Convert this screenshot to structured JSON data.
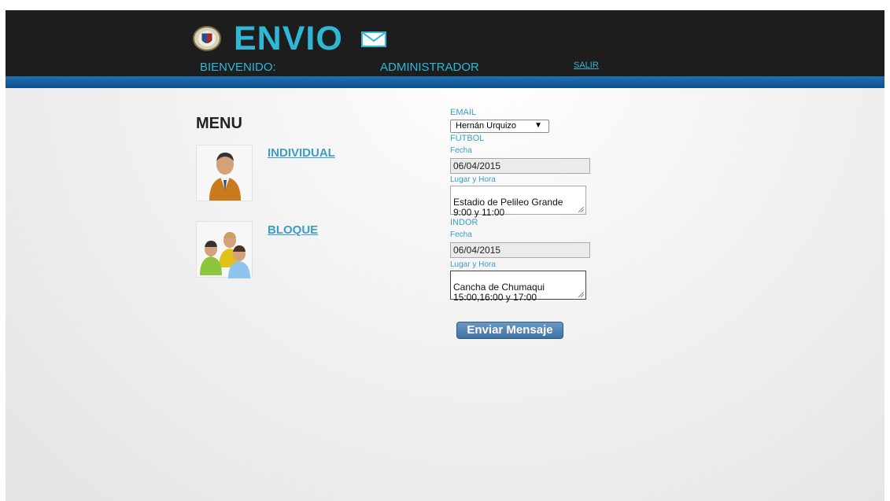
{
  "header": {
    "logo_text": "ENVIO",
    "welcome_label": "BIENVENIDO:",
    "user_name": "ADMINISTRADOR",
    "logout_label": "SALIR"
  },
  "menu": {
    "title": "MENU",
    "items": [
      {
        "label": "INDIVIDUAL",
        "icon": "single-user-icon"
      },
      {
        "label": "BLOQUE",
        "icon": "user-group-icon"
      }
    ]
  },
  "form": {
    "email_label": "EMAIL",
    "email_selected": "Hernán Urquizo",
    "futbol": {
      "section_label": "FÚTBOL",
      "date_label": "Fecha",
      "date_value": "06/04/2015",
      "place_label": "Lugar y Hora",
      "place_value": "Estadio de Pelileo Grande 9:00 y 11:00"
    },
    "indor": {
      "section_label": "INDOR",
      "date_label": "Fecha",
      "date_value": "06/04/2015",
      "place_label": "Lugar y Hora",
      "place_value": "Cancha de Chumaqui 15:00,16:00 y 17:00"
    },
    "submit_label": "Enviar Mensaje"
  },
  "colors": {
    "accent": "#2fb8d6",
    "link": "#3a9dc8",
    "header_bg": "#1c1c1c",
    "strip": "#1f6fb1",
    "button": "#4f80b0"
  }
}
